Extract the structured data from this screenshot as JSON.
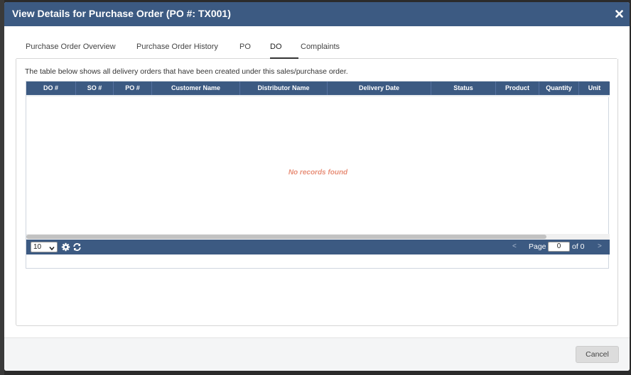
{
  "modal": {
    "title": "View Details for Purchase Order (PO #: TX001)"
  },
  "tabs": [
    {
      "label": "Purchase Order Overview"
    },
    {
      "label": "Purchase Order History"
    },
    {
      "label": "PO"
    },
    {
      "label": "DO"
    },
    {
      "label": "Complaints"
    }
  ],
  "active_tab": "DO",
  "panel": {
    "description": "The table below shows all delivery orders that have been created under this sales/purchase order."
  },
  "grid": {
    "columns": [
      "DO #",
      "SO #",
      "PO #",
      "Customer Name",
      "Distributor Name",
      "Delivery Date",
      "Status",
      "Product",
      "Quantity",
      "Unit"
    ],
    "empty_message": "No records found"
  },
  "pager": {
    "page_size": "10",
    "page_label": "Page",
    "page_value": "0",
    "of_label": "of 0",
    "prev": "<",
    "next": ">"
  },
  "footer": {
    "cancel_label": "Cancel"
  },
  "colors": {
    "header_bg": "#3c5a82",
    "empty_text": "#e8907a"
  }
}
